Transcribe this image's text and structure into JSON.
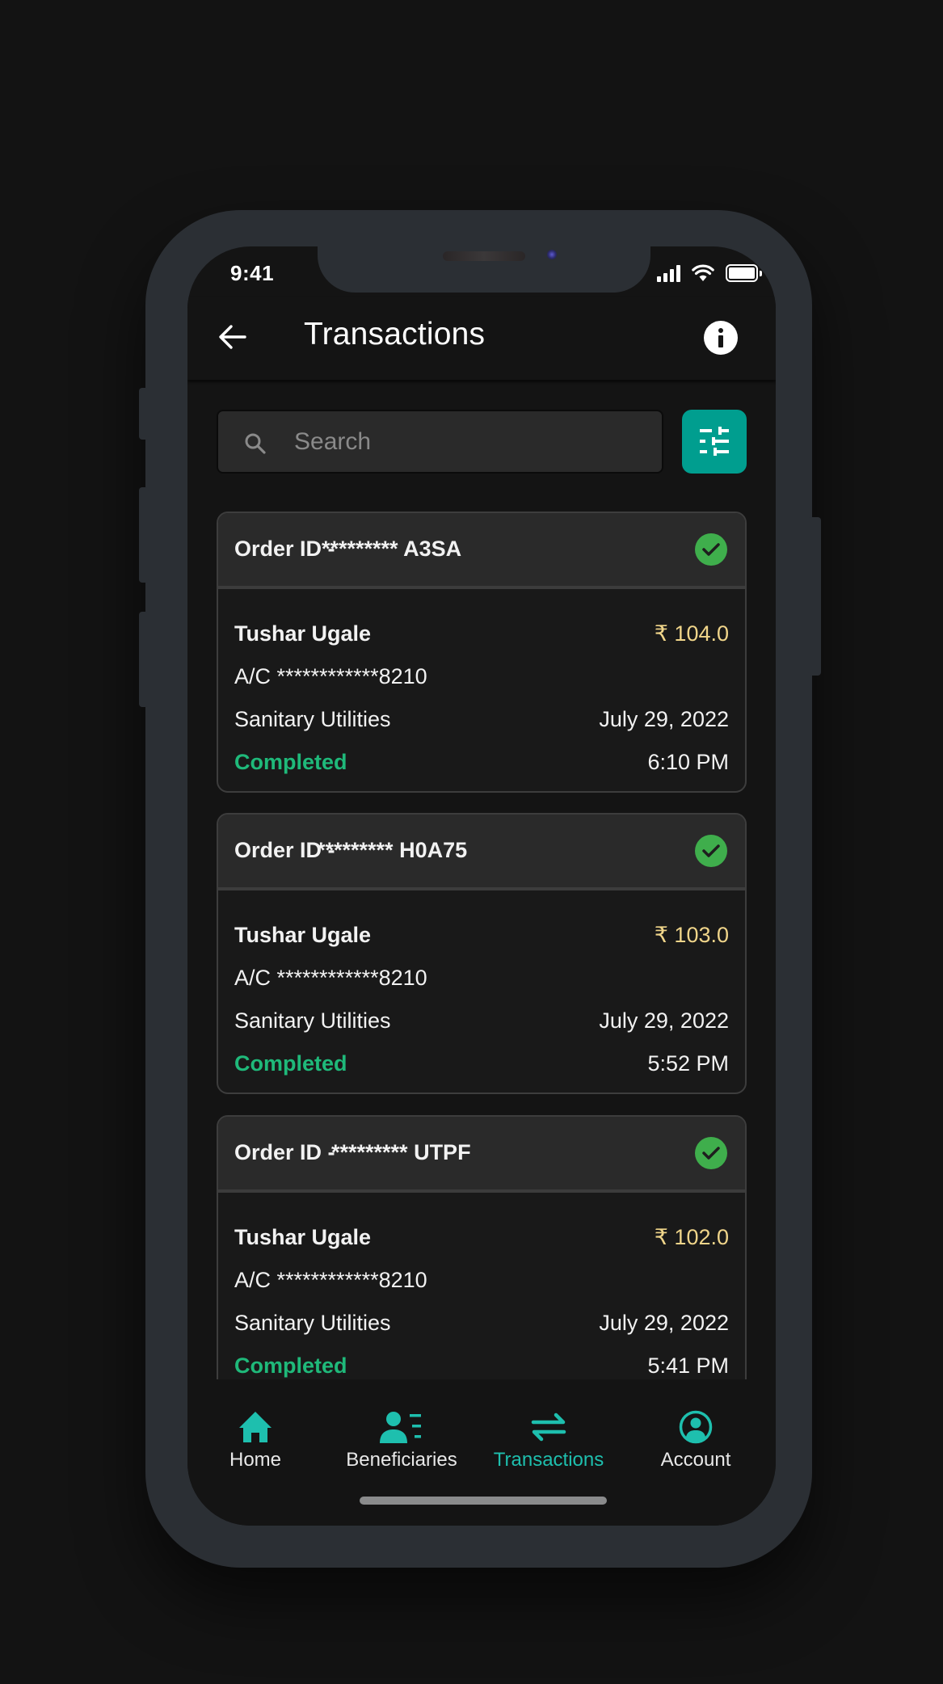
{
  "status_bar": {
    "time": "9:41"
  },
  "header": {
    "title": "Transactions",
    "back_icon": "arrow-left-icon",
    "info_icon": "info-icon"
  },
  "search": {
    "placeholder": "Search",
    "value": "",
    "icon": "search-icon",
    "filter_icon": "tune-sliders-icon"
  },
  "colors": {
    "accent": "#009e8f",
    "active_nav": "#1ebfae",
    "amount": "#f0d58a",
    "completed": "#1fb97a",
    "check_badge": "#3fae4c",
    "screen_bg": "#141414",
    "card_header_bg": "#2a2a2a"
  },
  "transactions": [
    {
      "order_label": "Order ID -",
      "order_id": "********* A3SA",
      "name": "Tushar Ugale",
      "amount": "₹ 104.0",
      "account": "A/C ************8210",
      "category": "Sanitary Utilities",
      "date": "July 29, 2022",
      "status": "Completed",
      "time": "6:10 PM"
    },
    {
      "order_label": "Order ID -",
      "order_id": "********* H0A75",
      "name": "Tushar Ugale",
      "amount": "₹ 103.0",
      "account": "A/C ************8210",
      "category": "Sanitary Utilities",
      "date": "July 29, 2022",
      "status": "Completed",
      "time": "5:52 PM"
    },
    {
      "order_label": "Order ID -",
      "order_id": "********* UTPF",
      "name": "Tushar Ugale",
      "amount": "₹ 102.0",
      "account": "A/C ************8210",
      "category": "Sanitary Utilities",
      "date": "July 29, 2022",
      "status": "Completed",
      "time": "5:41 PM"
    }
  ],
  "bottom_nav": {
    "items": [
      {
        "label": "Home",
        "icon": "home-icon",
        "active": false
      },
      {
        "label": "Beneficiaries",
        "icon": "beneficiaries-icon",
        "active": false
      },
      {
        "label": "Transactions",
        "icon": "swap-arrows-icon",
        "active": true
      },
      {
        "label": "Account",
        "icon": "account-circle-icon",
        "active": false
      }
    ]
  }
}
